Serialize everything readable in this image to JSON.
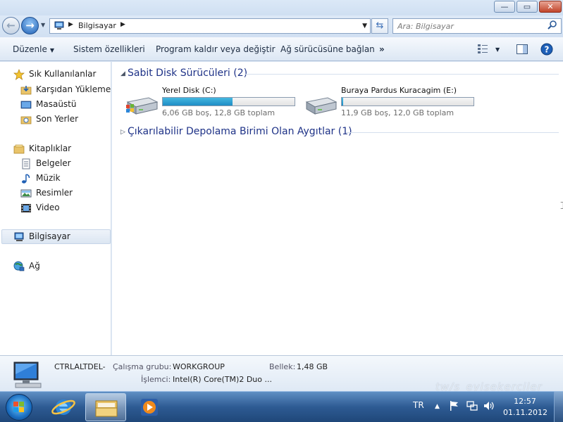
{
  "window": {
    "minimize_glyph": "—",
    "maximize_glyph": "▭",
    "close_glyph": "✕"
  },
  "address": {
    "crumb": "Bilgisayar",
    "search_placeholder": "Ara: Bilgisayar"
  },
  "toolbar": {
    "organize": "Düzenle",
    "system_properties": "Sistem özellikleri",
    "uninstall": "Program kaldır veya değiştir",
    "map_drive": "Ağ sürücüsüne bağlan",
    "more": "»"
  },
  "sidebar": {
    "favorites": "Sık Kullanılanlar",
    "downloads": "Karşıdan Yüklemeler",
    "desktop": "Masaüstü",
    "recent": "Son Yerler",
    "libraries": "Kitaplıklar",
    "documents": "Belgeler",
    "music": "Müzik",
    "pictures": "Resimler",
    "videos": "Video",
    "computer": "Bilgisayar",
    "network": "Ağ"
  },
  "content": {
    "hdd_group": "Sabit Disk Sürücüleri (2)",
    "removable_group": "Çıkarılabilir Depolama Birimi Olan Aygıtlar (1)",
    "drives": [
      {
        "name": "Yerel Disk (C:)",
        "info": "6,06 GB boş, 12,8 GB toplam",
        "used_fraction": 0.53
      },
      {
        "name": "Buraya Pardus Kuracagim (E:)",
        "info": "11,9 GB boş, 12,0 GB toplam",
        "used_fraction": 0.01
      }
    ]
  },
  "details": {
    "computer_name": "CTRLALTDEL-",
    "workgroup_label": "Çalışma grubu:",
    "workgroup_value": "WORKGROUP",
    "memory_label": "Bellek:",
    "memory_value": "1,48 GB",
    "cpu_label": "İşlemci:",
    "cpu_value": "Intel(R) Core(TM)2 Duo ..."
  },
  "taskbar": {
    "language": "TR",
    "time": "12:57",
    "date": "01.11.2012"
  },
  "watermark": "tw/s_eyisekerciler",
  "colors": {
    "group_title": "#1e3287",
    "drive_bar_fill": "#1e8dc5",
    "taskbar": "#2e5b93"
  }
}
